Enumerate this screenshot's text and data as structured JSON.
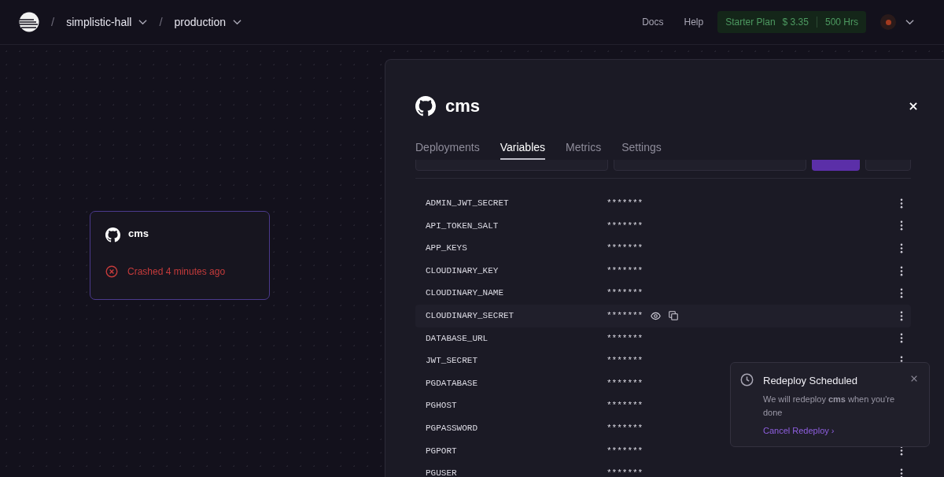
{
  "breadcrumbs": [
    {
      "separator": "/",
      "label": "simplistic-hall"
    },
    {
      "separator": "/",
      "label": "production"
    }
  ],
  "nav": [
    "Docs",
    "Help"
  ],
  "plan": {
    "name": "Starter Plan",
    "cost": "$ 3.35",
    "hours": "500 Hrs"
  },
  "service_card": {
    "name": "cms",
    "status": "Crashed 4 minutes ago"
  },
  "panel": {
    "title": "cms",
    "tabs": [
      {
        "label": "Deployments",
        "selected": false
      },
      {
        "label": "Variables",
        "selected": true
      },
      {
        "label": "Metrics",
        "selected": false
      },
      {
        "label": "Settings",
        "selected": false
      }
    ],
    "variables": [
      {
        "name": "ADMIN_JWT_SECRET",
        "value": "*******",
        "hovered": false
      },
      {
        "name": "API_TOKEN_SALT",
        "value": "*******",
        "hovered": false
      },
      {
        "name": "APP_KEYS",
        "value": "*******",
        "hovered": false
      },
      {
        "name": "CLOUDINARY_KEY",
        "value": "*******",
        "hovered": false
      },
      {
        "name": "CLOUDINARY_NAME",
        "value": "*******",
        "hovered": false
      },
      {
        "name": "CLOUDINARY_SECRET",
        "value": "*******",
        "hovered": true
      },
      {
        "name": "DATABASE_URL",
        "value": "*******",
        "hovered": false
      },
      {
        "name": "JWT_SECRET",
        "value": "*******",
        "hovered": false
      },
      {
        "name": "PGDATABASE",
        "value": "*******",
        "hovered": false
      },
      {
        "name": "PGHOST",
        "value": "*******",
        "hovered": false
      },
      {
        "name": "PGPASSWORD",
        "value": "*******",
        "hovered": false
      },
      {
        "name": "PGPORT",
        "value": "*******",
        "hovered": false
      },
      {
        "name": "PGUSER",
        "value": "*******",
        "hovered": false
      }
    ]
  },
  "toast": {
    "title": "Redeploy Scheduled",
    "message": "We will redeploy **cms** when you're done",
    "action": "Cancel Redeploy ›"
  }
}
